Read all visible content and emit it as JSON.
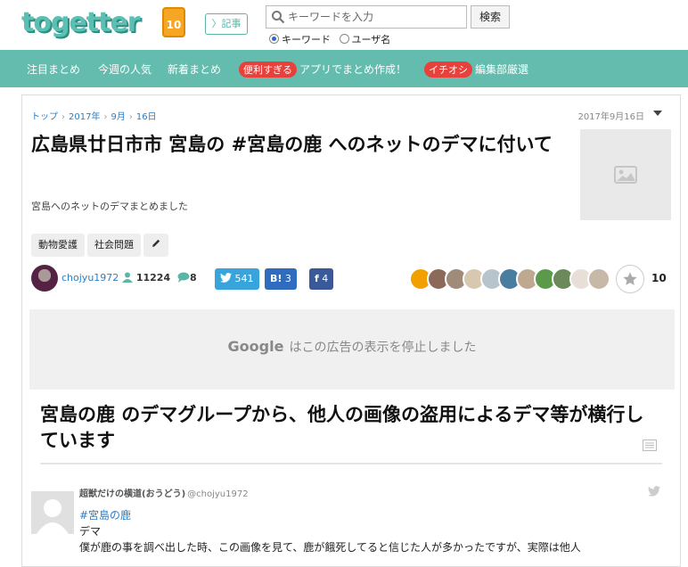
{
  "header": {
    "logo_text": "togetter",
    "logo_badge": "10",
    "memo_label": "〉記事",
    "search": {
      "placeholder": "キーワードを入力",
      "button_label": "検索"
    },
    "radio_options": [
      {
        "label": "キーワード",
        "selected": true
      },
      {
        "label": "ユーザ名",
        "selected": false
      }
    ]
  },
  "nav": {
    "items": [
      {
        "label": "注目まとめ"
      },
      {
        "label": "今週の人気"
      },
      {
        "label": "新着まとめ"
      },
      {
        "pill": "便利すぎる",
        "label": "アプリでまとめ作成！"
      },
      {
        "pill": "イチオシ",
        "label": "編集部厳選"
      }
    ],
    "nav_color": "#63bcad",
    "pill_color": "#e8413c"
  },
  "article": {
    "breadcrumb": [
      "トップ",
      "2017年",
      "9月",
      "16日"
    ],
    "date": "2017年9月16日",
    "title": "広島県廿日市市 宮島の #宮島の鹿 へのネットのデマに付いて",
    "description": "宮島へのネットのデマまとめました",
    "tags": [
      "動物愛護",
      "社会問題"
    ],
    "author": "chojyu1972",
    "view_count": "11224",
    "comment_count": "8",
    "twitter_count": "541",
    "hatena_label": "B!",
    "hatena_count": "3",
    "facebook_label": "f",
    "facebook_count": "4",
    "favorite_count": "10"
  },
  "ad": {
    "google": "Google",
    "message": "はこの広告の表示を停止しました"
  },
  "section": {
    "heading": "宮島の鹿 のデマグループから、他人の画像の盗用によるデマ等が横行しています"
  },
  "tweet": {
    "name": "超獣だけの横道(おうどう)",
    "handle": "@chojyu1972",
    "hashtag": "#宮島の鹿",
    "line1": "デマ",
    "line2": "僕が鹿の事を調べ出した時、この画像を見て、鹿が餓死してると信じた人が多かったですが、実際は他人"
  }
}
